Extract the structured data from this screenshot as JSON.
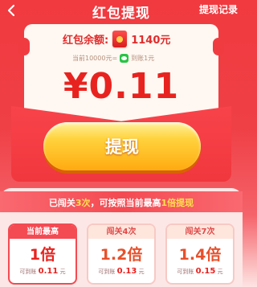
{
  "header": {
    "title": "红包提现",
    "record_label": "提现记录"
  },
  "balance": {
    "label": "红包余额:",
    "value": "1140元",
    "conversion": "当前10000元=",
    "conversion_suffix": "到账1元"
  },
  "amount": "¥0.11",
  "withdraw_button": "提现",
  "info": {
    "prefix": "已闯关",
    "count": "3次",
    "middle": "，可按照当前最高",
    "multiplier": "1倍提现"
  },
  "tiers": [
    {
      "tag": "当前最高",
      "multiplier": "1倍",
      "can_label": "可到账",
      "amount": "0.11",
      "unit": "元"
    },
    {
      "tag": "闯关4次",
      "multiplier": "1.2倍",
      "can_label": "可到账",
      "amount": "0.13",
      "unit": "元"
    },
    {
      "tag": "闯关7次",
      "multiplier": "1.4倍",
      "can_label": "可到账",
      "amount": "0.15",
      "unit": "元"
    }
  ],
  "colors": {
    "primary_red": "#f03a3f",
    "highlight_yellow": "#ffe14d",
    "button_orange": "#ffaa10"
  }
}
